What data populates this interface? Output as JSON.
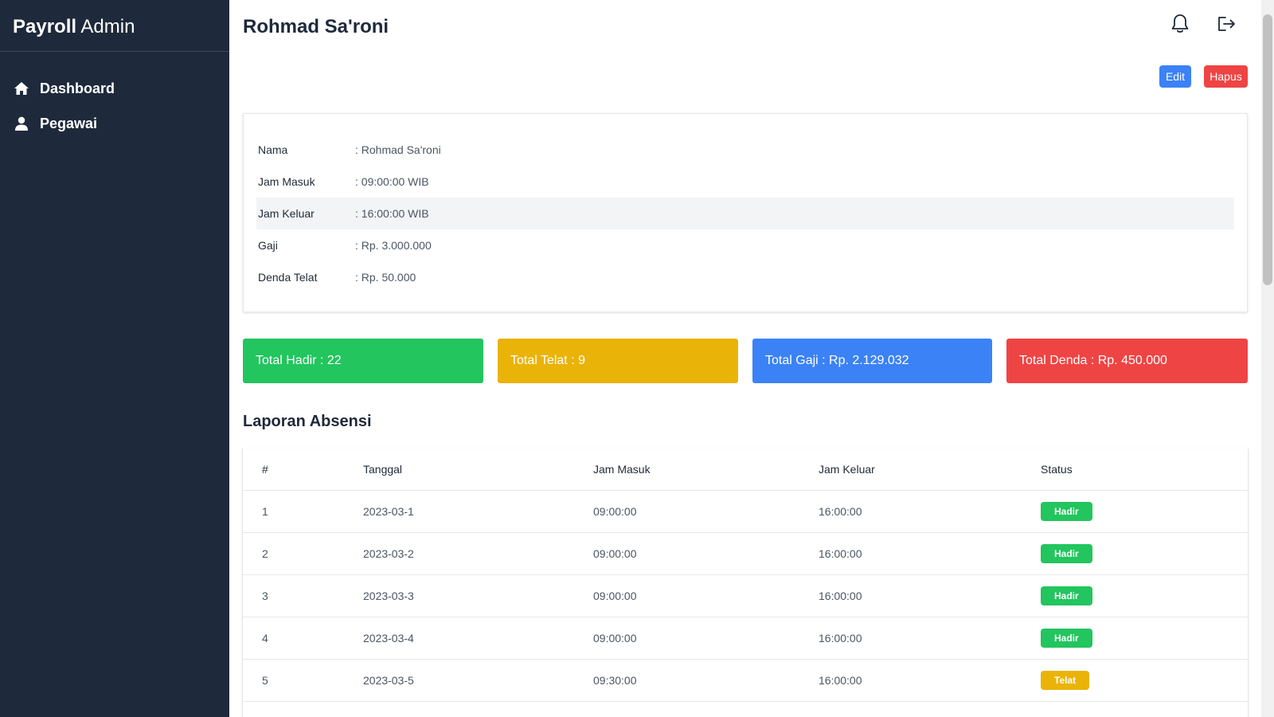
{
  "app": {
    "brand_bold": "Payroll",
    "brand_light": "Admin"
  },
  "sidebar": {
    "items": [
      {
        "label": "Dashboard",
        "icon": "home-icon"
      },
      {
        "label": "Pegawai",
        "icon": "user-icon"
      }
    ]
  },
  "header": {
    "title": "Rohmad Sa'roni",
    "icons": [
      "bell-icon",
      "logout-icon"
    ],
    "edit_label": "Edit",
    "delete_label": "Hapus"
  },
  "info": {
    "rows": [
      {
        "label": "Nama",
        "value": ": Rohmad Sa'roni"
      },
      {
        "label": "Jam Masuk",
        "value": ": 09:00:00 WIB"
      },
      {
        "label": "Jam Keluar",
        "value": ": 16:00:00 WIB"
      },
      {
        "label": "Gaji",
        "value": ": Rp. 3.000.000"
      },
      {
        "label": "Denda Telat",
        "value": ": Rp. 50.000"
      }
    ]
  },
  "stats": {
    "hadir": "Total Hadir : 22",
    "telat": "Total Telat : 9",
    "gaji": "Total Gaji : Rp. 2.129.032",
    "denda": "Total Denda : Rp. 450.000"
  },
  "colors": {
    "hadir": "#22c55e",
    "telat": "#eab308",
    "gaji": "#3b82f6",
    "denda": "#ef4444",
    "sidebar": "#1e293b"
  },
  "report": {
    "title": "Laporan Absensi",
    "headers": [
      "#",
      "Tanggal",
      "Jam Masuk",
      "Jam Keluar",
      "Status"
    ],
    "rows": [
      {
        "no": "1",
        "tanggal": "2023-03-1",
        "masuk": "09:00:00",
        "keluar": "16:00:00",
        "status": "Hadir"
      },
      {
        "no": "2",
        "tanggal": "2023-03-2",
        "masuk": "09:00:00",
        "keluar": "16:00:00",
        "status": "Hadir"
      },
      {
        "no": "3",
        "tanggal": "2023-03-3",
        "masuk": "09:00:00",
        "keluar": "16:00:00",
        "status": "Hadir"
      },
      {
        "no": "4",
        "tanggal": "2023-03-4",
        "masuk": "09:00:00",
        "keluar": "16:00:00",
        "status": "Hadir"
      },
      {
        "no": "5",
        "tanggal": "2023-03-5",
        "masuk": "09:30:00",
        "keluar": "16:00:00",
        "status": "Telat"
      }
    ]
  }
}
